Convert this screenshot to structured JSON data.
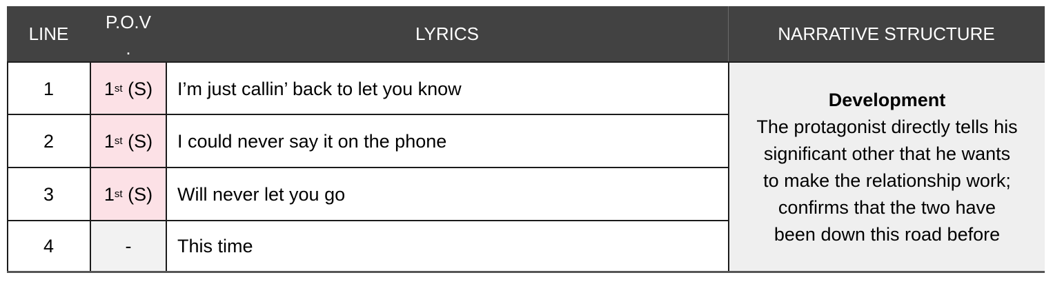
{
  "header": {
    "line": "LINE",
    "pov_top": "P.O.V",
    "pov_bottom": ".",
    "lyrics": "LYRICS",
    "narrative": "NARRATIVE STRUCTURE"
  },
  "rows": [
    {
      "line": "1",
      "pov_base": "1",
      "pov_sup": "st",
      "pov_tail": " (S)",
      "lyric": "I’m just callin’ back to let you know"
    },
    {
      "line": "2",
      "pov_base": "1",
      "pov_sup": "st",
      "pov_tail": " (S)",
      "lyric": "I could never say it on the phone"
    },
    {
      "line": "3",
      "pov_base": "1",
      "pov_sup": "st",
      "pov_tail": " (S)",
      "lyric": "Will never let you go"
    },
    {
      "line": "4",
      "pov_dash": "-",
      "lyric": "This time"
    }
  ],
  "narrative": {
    "title": "Development",
    "lines": [
      "The protagonist directly tells his",
      "significant other that he wants",
      "to make the relationship work;",
      "confirms that the two have",
      "been down this road before"
    ]
  },
  "colors": {
    "header_bg": "#424242",
    "pov_highlight": "#fce1e6",
    "narrative_bg": "#efefef"
  }
}
